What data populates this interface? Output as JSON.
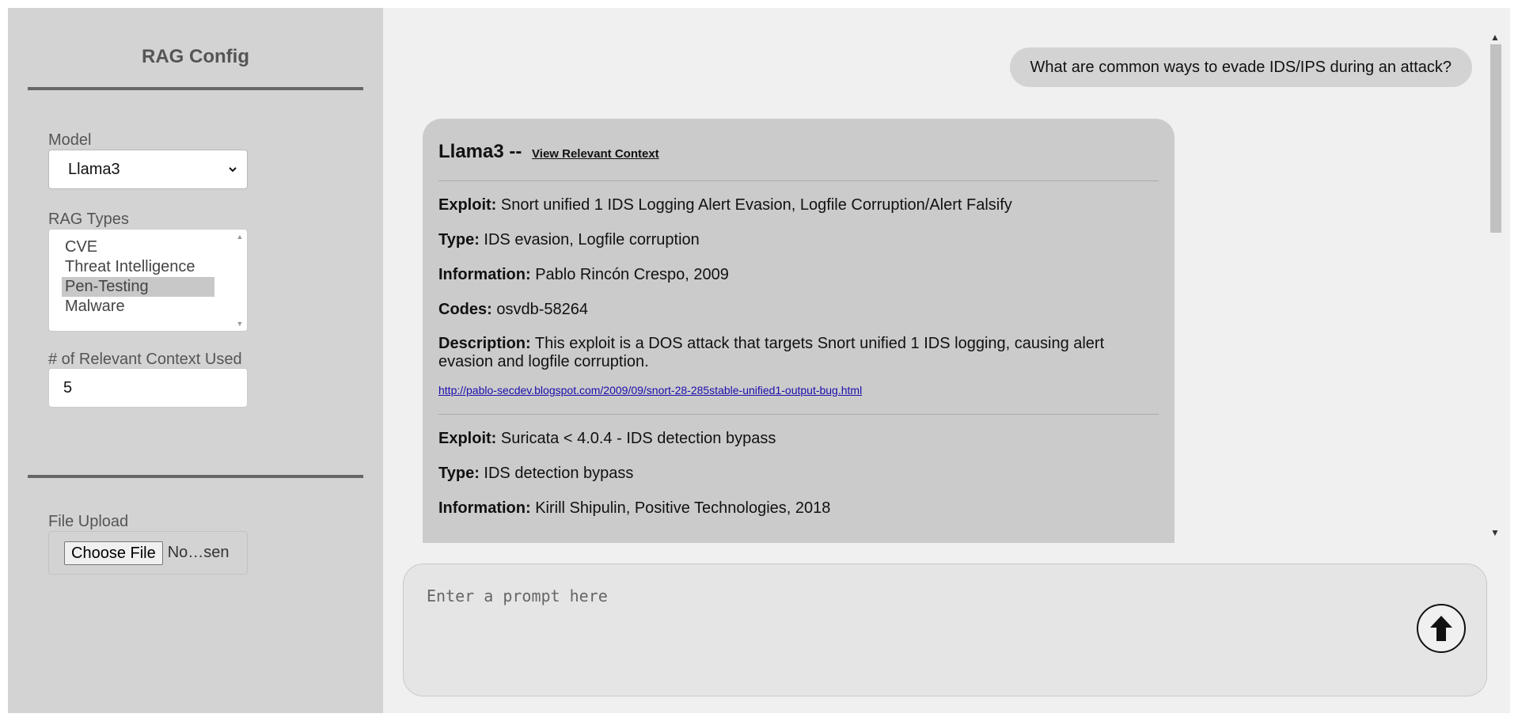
{
  "sidebar": {
    "title": "RAG Config",
    "model": {
      "label": "Model",
      "selected": "Llama3"
    },
    "rag_types": {
      "label": "RAG Types",
      "options": [
        "CVE",
        "Threat Intelligence",
        "Pen-Testing",
        "Malware"
      ],
      "selected": "Pen-Testing"
    },
    "context": {
      "label": "# of Relevant Context Used",
      "value": "5"
    },
    "file_upload": {
      "label": "File Upload",
      "button": "Choose File",
      "status": "No…sen"
    }
  },
  "chat": {
    "user_message": "What are common ways to evade IDS/IPS during an attack?",
    "bot": {
      "name": "Llama3 --",
      "context_link": "View Relevant Context",
      "entries": [
        {
          "exploit_label": "Exploit:",
          "exploit": "Snort unified 1 IDS Logging Alert Evasion, Logfile Corruption/Alert Falsify",
          "type_label": "Type:",
          "type": "IDS evasion, Logfile corruption",
          "info_label": "Information:",
          "info": "Pablo Rincón Crespo, 2009",
          "codes_label": "Codes:",
          "codes": "osvdb-58264",
          "desc_label": "Description:",
          "desc": "This exploit is a DOS attack that targets Snort unified 1 IDS logging, causing alert evasion and logfile corruption.",
          "url": "http://pablo-secdev.blogspot.com/2009/09/snort-28-285stable-unified1-output-bug.html"
        },
        {
          "exploit_label": "Exploit:",
          "exploit": "Suricata < 4.0.4 - IDS detection bypass",
          "type_label": "Type:",
          "type": "IDS detection bypass",
          "info_label": "Information:",
          "info": "Kirill Shipulin, Positive Technologies, 2018"
        }
      ]
    }
  },
  "prompt": {
    "placeholder": "Enter a prompt here"
  }
}
